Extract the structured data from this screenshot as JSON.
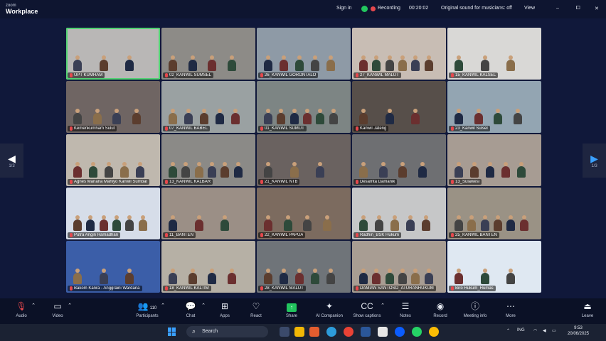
{
  "titlebar": {
    "brand_line1": "zoom",
    "brand_line2": "Workplace",
    "sign_in": "Sign in",
    "recording": "Recording",
    "timer": "00:20:02",
    "original_sound": "Original sound for musicians: off",
    "view": "View"
  },
  "window_controls": {
    "minimize": "–",
    "maximize": "⧠",
    "close": "✕"
  },
  "pager": {
    "left_page": "1/3",
    "right_page": "1/3",
    "left_arrow": "◀",
    "right_arrow": "▶"
  },
  "tiles": [
    {
      "label": "UPT KUMHAM",
      "bg": "#b9b7b6",
      "active": true
    },
    {
      "label": "02_KANWIL SUMSEL",
      "bg": "#8d8b87"
    },
    {
      "label": "26_KANWIL GORONTALO",
      "bg": "#8e9aa6"
    },
    {
      "label": "27_KANWIL MALUT",
      "bg": "#c8bdb4"
    },
    {
      "label": "15_KANWIL KALSEL",
      "bg": "#d9d8d6"
    },
    {
      "label": "Kemenkumham Sulut",
      "bg": "#6f6563"
    },
    {
      "label": "07_KANWIL BABEL",
      "bg": "#9aa1a2"
    },
    {
      "label": "01_KANWIL SUMUT",
      "bg": "#7d8584"
    },
    {
      "label": "Kanwil Jateng",
      "bg": "#574f4a"
    },
    {
      "label": "23_Kanwil Sulsel",
      "bg": "#93a5b2"
    },
    {
      "label": "Agnes Mariana Mahiyo Kanwil Sumbar",
      "bg": "#bfb8ae"
    },
    {
      "label": "13_KANWIL KALBAR",
      "bg": "#8b8a87"
    },
    {
      "label": "21_KANWIL NTB",
      "bg": "#6a6260"
    },
    {
      "label": "Desamta Damanik",
      "bg": "#6e6f72"
    },
    {
      "label": "13_Sulawesi",
      "bg": "#a79c93"
    },
    {
      "label": "Putra Angin Ramadhan",
      "bg": "#d6dde9"
    },
    {
      "label": "11_BANTEN",
      "bg": "#9b8f86"
    },
    {
      "label": "22_KANWIL PAPUA",
      "bg": "#7c6b5f"
    },
    {
      "label": "Radhin_BSK Hukum",
      "bg": "#c6c7c8"
    },
    {
      "label": "25_KANWIL BANTEN",
      "bg": "#9a9285"
    },
    {
      "label": "Bakom Kanra - Anggraini Wardana",
      "bg": "#3b5ea8"
    },
    {
      "label": "18_KANWIL KALTIM",
      "bg": "#b6b0a5"
    },
    {
      "label": "28_KANWIL MALUT",
      "bg": "#6f7479"
    },
    {
      "label": "DAMIAN SANTOSO_ATURANHUKUM",
      "bg": "#a89d93"
    },
    {
      "label": "Biro Hukum_Humas",
      "bg": "#dfe8f2"
    }
  ],
  "toolbar": [
    {
      "label": "Audio",
      "icon": "mic-muted-icon"
    },
    {
      "label": "Video",
      "icon": "video-icon"
    },
    {
      "label": "Participants",
      "icon": "participants-icon",
      "count": "110"
    },
    {
      "label": "Chat",
      "icon": "chat-icon"
    },
    {
      "label": "Apps",
      "icon": "apps-icon"
    },
    {
      "label": "React",
      "icon": "heart-icon"
    },
    {
      "label": "Share",
      "icon": "share-icon"
    },
    {
      "label": "AI Companion",
      "icon": "sparkle-icon"
    },
    {
      "label": "Show captions",
      "icon": "captions-icon"
    },
    {
      "label": "Notes",
      "icon": "notes-icon"
    },
    {
      "label": "Record",
      "icon": "record-icon"
    },
    {
      "label": "Meeting info",
      "icon": "info-icon"
    },
    {
      "label": "More",
      "icon": "more-icon"
    },
    {
      "label": "Leave",
      "icon": "leave-icon"
    }
  ],
  "taskbar": {
    "search_placeholder": "Search",
    "tray_lang": "ING",
    "tray_time": "9:53",
    "tray_date": "20/06/2025"
  },
  "colors": {
    "accent_green": "#22c55e",
    "record_red": "#e5484d",
    "active_outline": "#52d273"
  }
}
